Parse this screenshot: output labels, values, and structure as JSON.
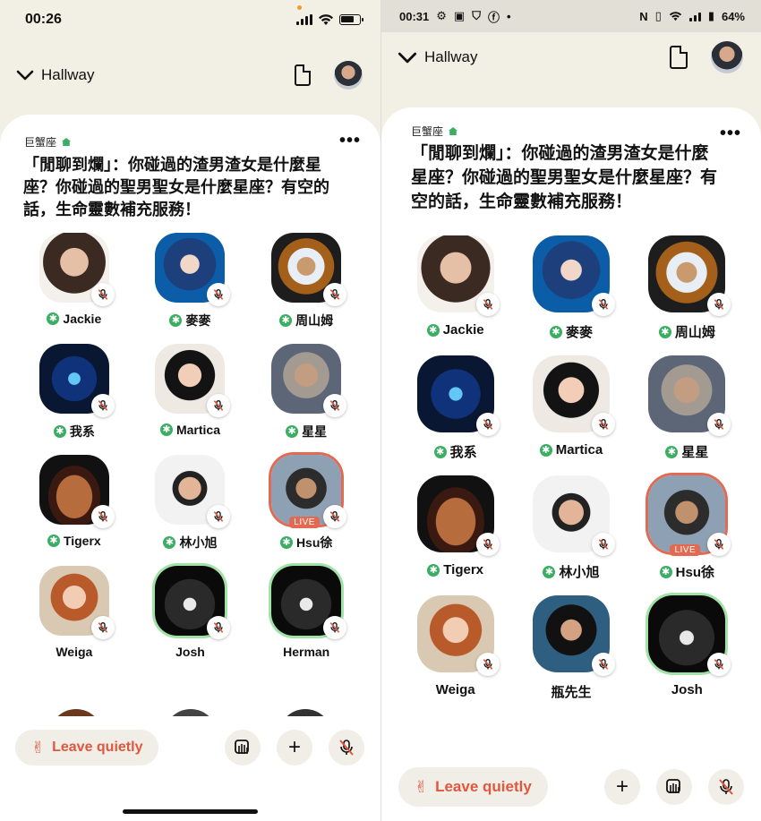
{
  "left": {
    "status": {
      "time": "00:26"
    },
    "header": {
      "hallway": "Hallway"
    },
    "room": {
      "club": "巨蟹座",
      "title": "「閒聊到爛」：你碰過的渣男渣女是什麼星座？你碰過的聖男聖女是什麼星座？有空的話，生命靈數補充服務！"
    },
    "speakers": [
      {
        "name": "Jackie",
        "mod": true,
        "fill": "f1"
      },
      {
        "name": "麥麥",
        "mod": true,
        "fill": "f2"
      },
      {
        "name": "周山姆",
        "mod": true,
        "fill": "f3"
      },
      {
        "name": "我系",
        "mod": true,
        "fill": "f4"
      },
      {
        "name": "Martica",
        "mod": true,
        "fill": "f5"
      },
      {
        "name": "星星",
        "mod": true,
        "fill": "f6"
      },
      {
        "name": "Tigerx",
        "mod": true,
        "fill": "f7"
      },
      {
        "name": "林小旭",
        "mod": true,
        "fill": "f8"
      },
      {
        "name": "Hsu徐",
        "mod": true,
        "fill": "f9",
        "live": "LIVE"
      },
      {
        "name": "Weiga",
        "mod": false,
        "fill": "f10"
      },
      {
        "name": "Josh",
        "mod": false,
        "fill": "f11",
        "ring": true
      },
      {
        "name": "Herman",
        "mod": false,
        "fill": "f11",
        "ring": true
      }
    ],
    "leave_label": "Leave quietly"
  },
  "right": {
    "status": {
      "time": "00:31",
      "battery": "64%"
    },
    "header": {
      "hallway": "Hallway"
    },
    "room": {
      "club": "巨蟹座",
      "title": "「閒聊到爛」：你碰過的渣男渣女是什麼星座？你碰過的聖男聖女是什麼星座？有空的話，生命靈數補充服務！"
    },
    "speakers": [
      {
        "name": "Jackie",
        "mod": true,
        "fill": "f1"
      },
      {
        "name": "麥麥",
        "mod": true,
        "fill": "f2"
      },
      {
        "name": "周山姆",
        "mod": true,
        "fill": "f3"
      },
      {
        "name": "我系",
        "mod": true,
        "fill": "f4"
      },
      {
        "name": "Martica",
        "mod": true,
        "fill": "f5"
      },
      {
        "name": "星星",
        "mod": true,
        "fill": "f6"
      },
      {
        "name": "Tigerx",
        "mod": true,
        "fill": "f7"
      },
      {
        "name": "林小旭",
        "mod": true,
        "fill": "f8"
      },
      {
        "name": "Hsu徐",
        "mod": true,
        "fill": "f9",
        "live": "LIVE"
      },
      {
        "name": "Weiga",
        "mod": false,
        "fill": "f10"
      },
      {
        "name": "瓶先生",
        "mod": false,
        "fill": "f12"
      },
      {
        "name": "Josh",
        "mod": false,
        "fill": "f11",
        "ring": true
      }
    ],
    "leave_label": "Leave quietly"
  },
  "icons": {
    "mod_badge": "✱",
    "more": "•••",
    "plus": "+",
    "hand": "✌"
  },
  "colors": {
    "accent_green": "#3bae64",
    "leave_red": "#e0573e",
    "live": "#e26a52"
  }
}
